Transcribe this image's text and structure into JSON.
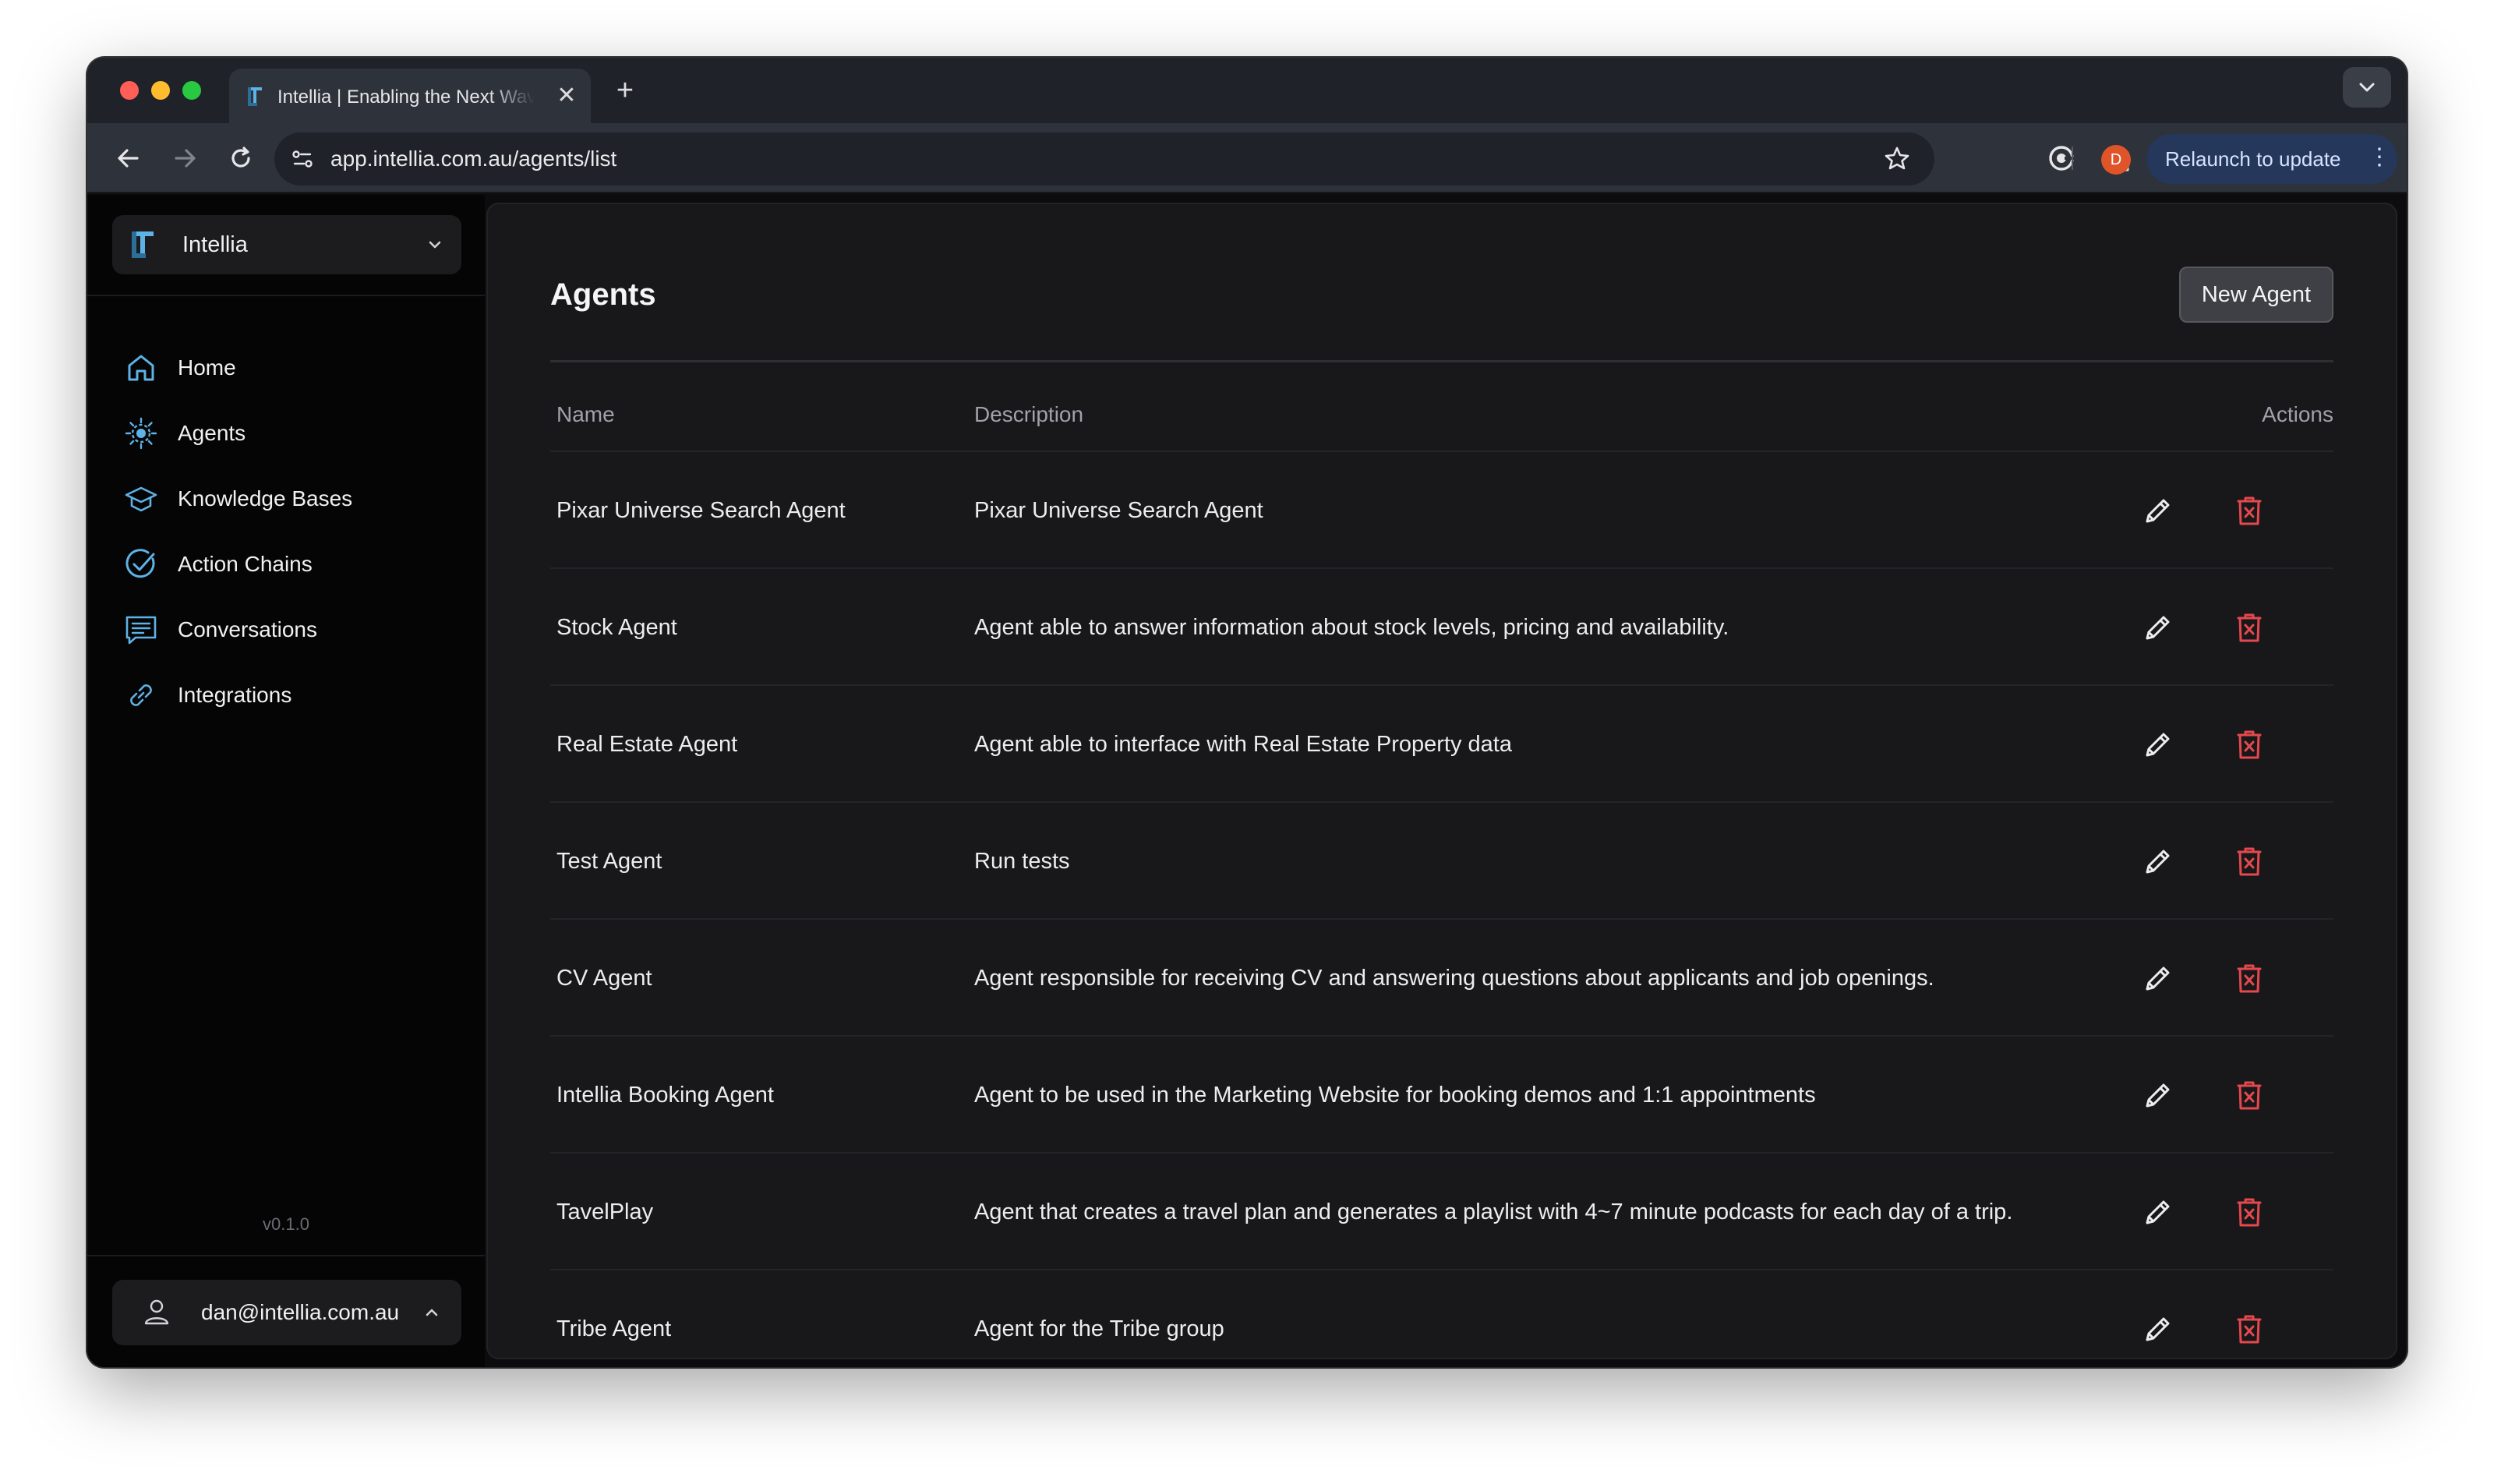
{
  "browser": {
    "tab_title": "Intellia | Enabling the Next Wave",
    "tab_close": "✕",
    "new_tab": "+",
    "url": "app.intellia.com.au/agents/list",
    "profile_initial": "D",
    "relaunch_label": "Relaunch to update",
    "relaunch_menu": "⋮",
    "traffic_light_colors": [
      "#ff5f57",
      "#febc2e",
      "#28c840"
    ]
  },
  "sidebar": {
    "org_name": "Intellia",
    "items": [
      {
        "label": "Home",
        "icon": "home-icon"
      },
      {
        "label": "Agents",
        "icon": "agents-icon"
      },
      {
        "label": "Knowledge Bases",
        "icon": "knowledge-bases-icon"
      },
      {
        "label": "Action Chains",
        "icon": "action-chains-icon"
      },
      {
        "label": "Conversations",
        "icon": "conversations-icon"
      },
      {
        "label": "Integrations",
        "icon": "integrations-icon"
      }
    ],
    "version": "v0.1.0",
    "user_email": "dan@intellia.com.au"
  },
  "page": {
    "title": "Agents",
    "new_agent_label": "New Agent"
  },
  "table": {
    "columns": {
      "name": "Name",
      "description": "Description",
      "actions": "Actions"
    },
    "rows": [
      {
        "name": "Pixar Universe Search Agent",
        "description": "Pixar Universe Search Agent"
      },
      {
        "name": "Stock Agent",
        "description": "Agent able to answer information about stock levels, pricing and availability."
      },
      {
        "name": "Real Estate Agent",
        "description": "Agent able to interface with Real Estate Property data"
      },
      {
        "name": "Test Agent",
        "description": "Run tests"
      },
      {
        "name": "CV Agent",
        "description": "Agent responsible for receiving CV and answering questions about applicants and job openings."
      },
      {
        "name": "Intellia Booking Agent",
        "description": "Agent to be used in the Marketing Website for booking demos and 1:1 appointments"
      },
      {
        "name": "TavelPlay",
        "description": "Agent that creates a travel plan and generates a playlist with 4~7 minute podcasts for each day of a trip."
      },
      {
        "name": "Tribe Agent",
        "description": "Agent for the Tribe group"
      }
    ]
  },
  "colors": {
    "accent_icon": "#5fb2e6",
    "delete_red": "#e5484d",
    "background": "#18181a"
  }
}
